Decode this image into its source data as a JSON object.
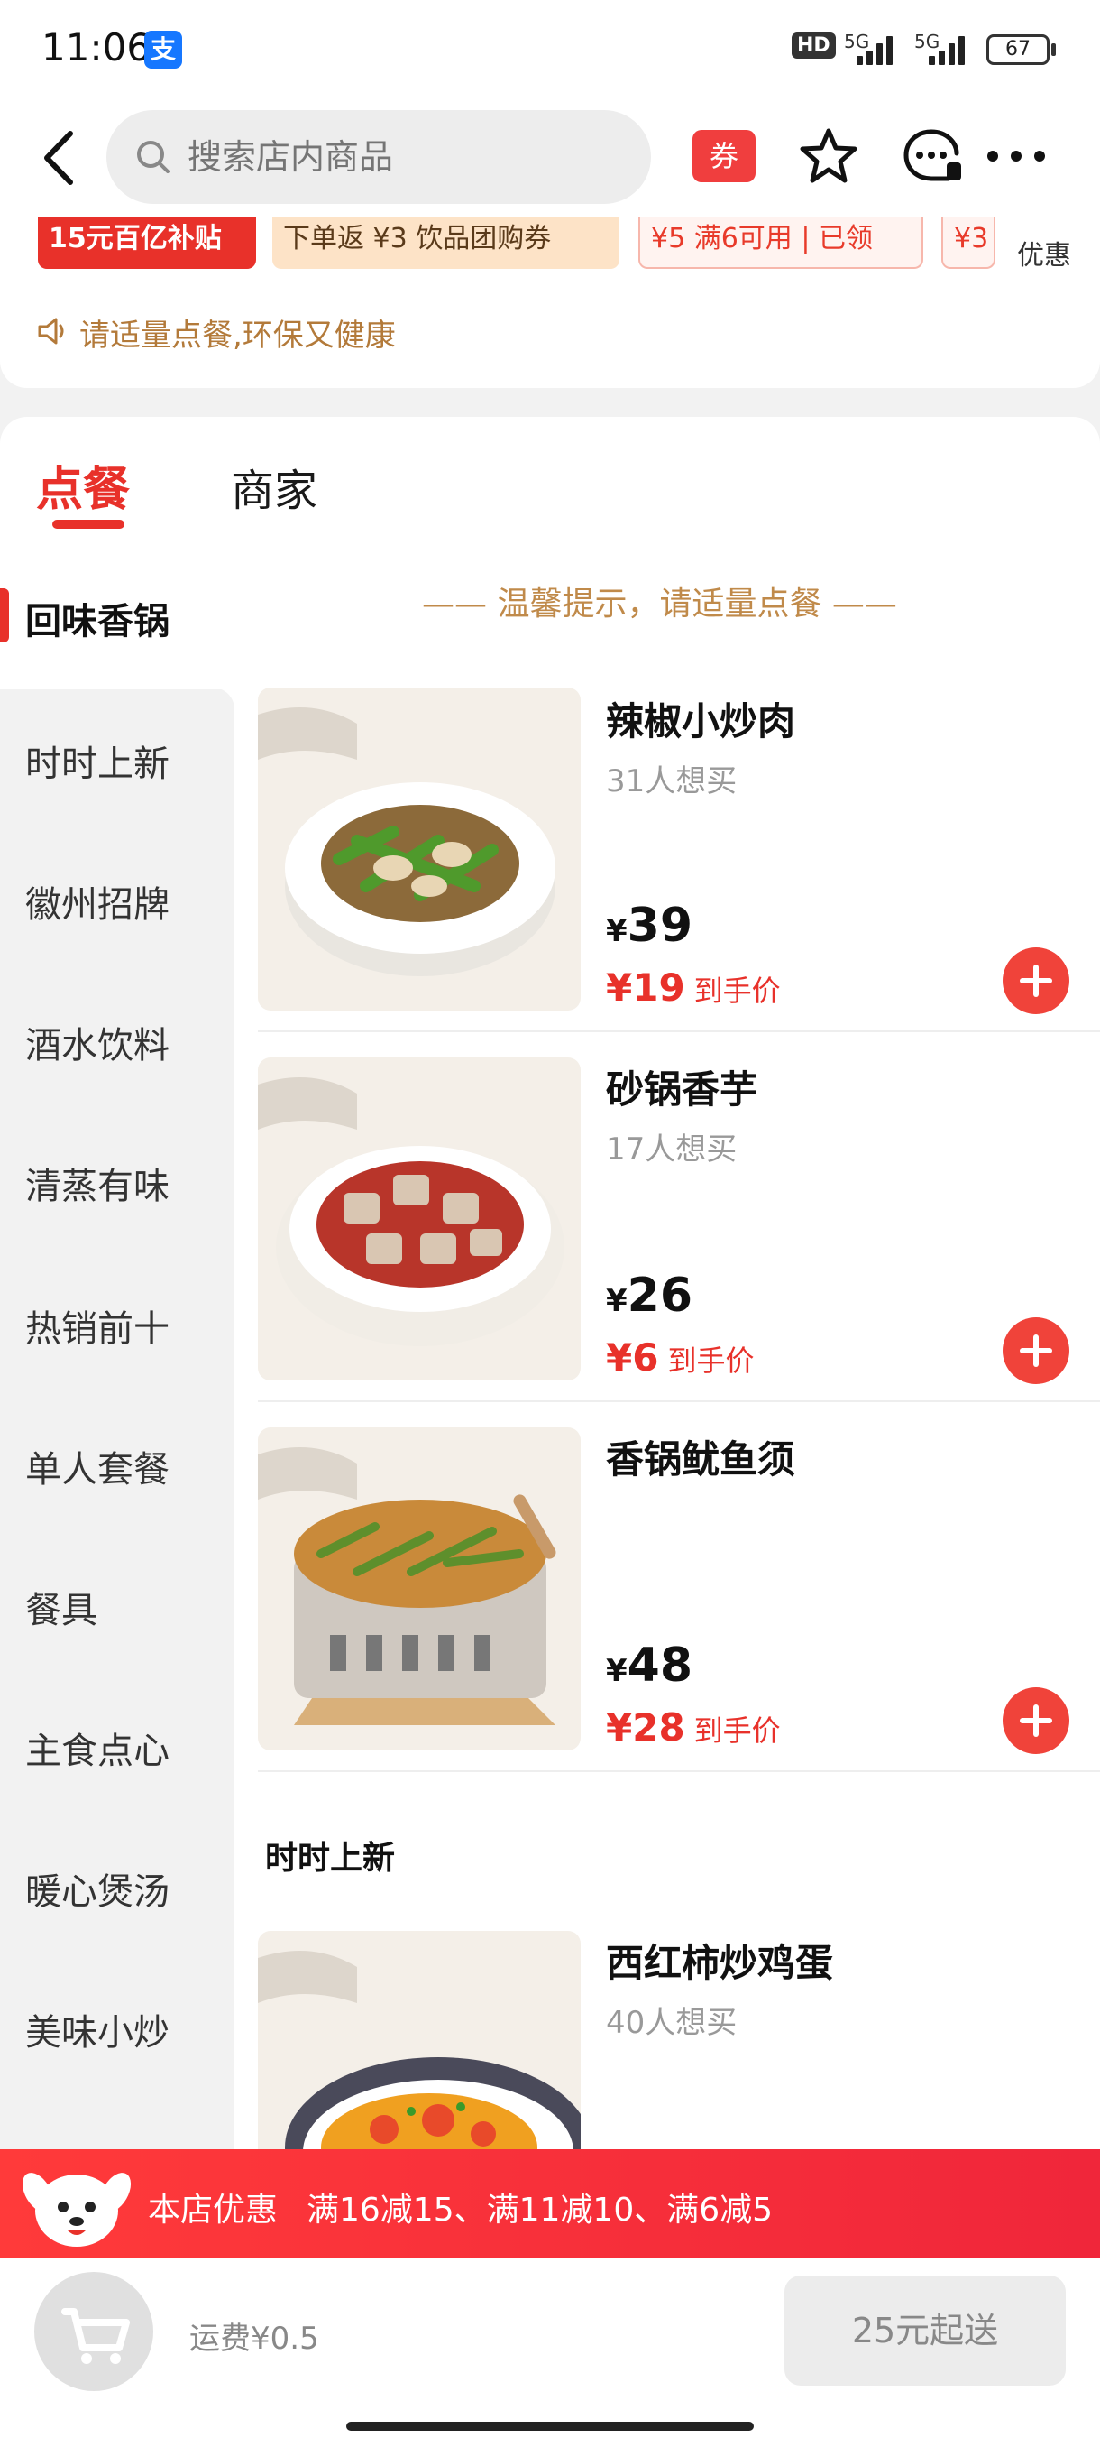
{
  "status_bar": {
    "time": "11:06",
    "alipay_badge": "支",
    "hd": "HD",
    "network_1": "5G",
    "network_2": "5G",
    "battery": "67"
  },
  "header": {
    "search_placeholder": "搜索店内商品",
    "coupon_label": "券"
  },
  "promos": {
    "coupons": [
      "15元百亿补贴",
      "下单返 ¥3 饮品团购券",
      "¥5 满6可用 | 已领",
      "¥3"
    ],
    "more_label": "优惠",
    "notice": "请适量点餐,环保又健康"
  },
  "tabs": {
    "order": "点餐",
    "merchant": "商家"
  },
  "sidebar": {
    "items": [
      "回味香锅",
      "时时上新",
      "徽州招牌",
      "酒水饮料",
      "清蒸有味",
      "热销前十",
      "单人套餐",
      "餐具",
      "主食点心",
      "暖心煲汤",
      "美味小炒"
    ]
  },
  "tip": "—— 温馨提示，请适量点餐 ——",
  "products": [
    {
      "name": "辣椒小炒肉",
      "wish": "31人想买",
      "currency": "¥",
      "price": "39",
      "final_price": "¥19",
      "final_label": "到手价"
    },
    {
      "name": "砂锅香芋",
      "wish": "17人想买",
      "currency": "¥",
      "price": "26",
      "final_price": "¥6",
      "final_label": "到手价"
    },
    {
      "name": "香锅鱿鱼须",
      "wish": "",
      "currency": "¥",
      "price": "48",
      "final_price": "¥28",
      "final_label": "到手价"
    },
    {
      "name": "西红柿炒鸡蛋",
      "wish": "40人想买"
    }
  ],
  "section_title": "时时上新",
  "promo_bar": {
    "label": "本店优惠",
    "detail": "满16减15、满11减10、满6减5"
  },
  "bottom": {
    "delivery_fee": "运费¥0.5",
    "min_order": "25元起送"
  },
  "colors": {
    "accent": "#e8312a",
    "tip": "#c08a4a"
  }
}
